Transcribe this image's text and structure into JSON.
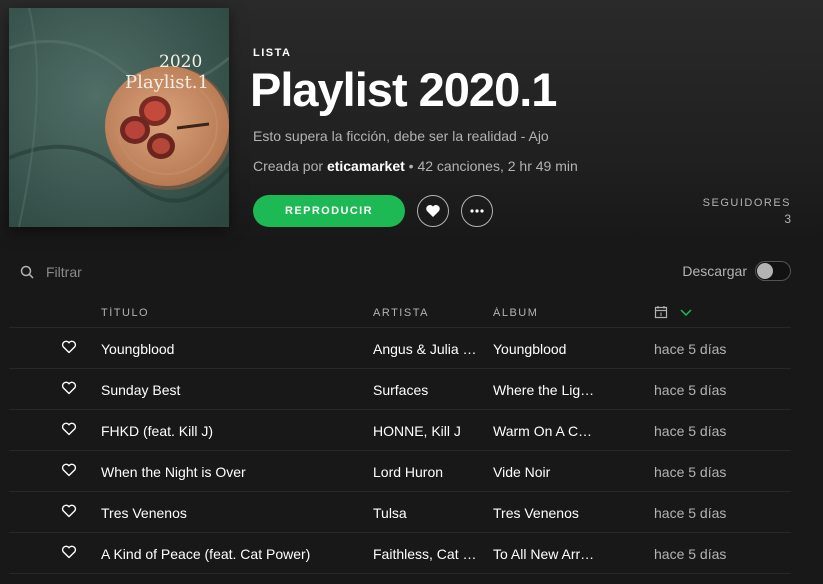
{
  "playlist": {
    "cover_year": "2020",
    "cover_name": "Playlist.1",
    "type_label": "LISTA",
    "title": "Playlist 2020.1",
    "description": "Esto supera la ficción, debe ser la realidad - Ajo",
    "meta_prefix": "Creada por",
    "owner": "eticamarket",
    "meta_suffix": "• 42 canciones, 2 hr 49 min",
    "play_label": "REPRODUCIR",
    "followers_label": "SEGUIDORES",
    "followers_count": "3"
  },
  "toolbar": {
    "filter_placeholder": "Filtrar",
    "download_label": "Descargar",
    "download_enabled": false
  },
  "table": {
    "headers": {
      "title": "TÍTULO",
      "artist": "ARTISTA",
      "album": "ÁLBUM"
    },
    "rows": [
      {
        "title": "Youngblood",
        "artist": "Angus & Julia …",
        "album": "Youngblood",
        "date": "hace 5 días"
      },
      {
        "title": "Sunday Best",
        "artist": "Surfaces",
        "album": "Where the Lig…",
        "date": "hace 5 días"
      },
      {
        "title": "FHKD (feat. Kill J)",
        "artist": "HONNE, Kill J",
        "album": "Warm On A C…",
        "date": "hace 5 días"
      },
      {
        "title": "When the Night is Over",
        "artist": "Lord Huron",
        "album": "Vide Noir",
        "date": "hace 5 días"
      },
      {
        "title": "Tres Venenos",
        "artist": "Tulsa",
        "album": "Tres Venenos",
        "date": "hace 5 días"
      },
      {
        "title": "A Kind of Peace (feat. Cat Power)",
        "artist": "Faithless, Cat …",
        "album": "To All New Arr…",
        "date": "hace 5 días"
      }
    ]
  },
  "icons": {
    "like": "heart-icon",
    "more": "more-icon",
    "search": "search-icon",
    "date": "calendar-icon",
    "sort": "chevron-down-icon"
  },
  "colors": {
    "accent": "#1db954",
    "background": "#181818",
    "secondary_text": "#b3b3b3"
  }
}
